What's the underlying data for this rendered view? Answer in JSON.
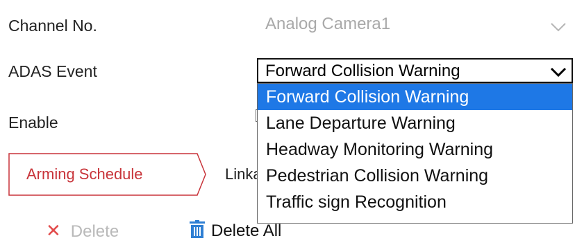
{
  "labels": {
    "channel": "Channel No.",
    "adas_event": "ADAS Event",
    "enable": "Enable"
  },
  "channel_select": {
    "value": "Analog Camera1",
    "disabled": true
  },
  "adas_select": {
    "value": "Forward Collision Warning",
    "options": [
      "Forward Collision Warning",
      "Lane Departure Warning",
      "Headway Monitoring Warning",
      "Pedestrian Collision Warning",
      "Traffic sign Recognition"
    ]
  },
  "tabs": {
    "active": "Arming Schedule",
    "next": "Linkage Method"
  },
  "buttons": {
    "delete": "Delete",
    "delete_all": "Delete All"
  },
  "colors": {
    "accent_red": "#c8343a",
    "selected_option": "#1e78e6",
    "trash_icon": "#2f7fd3"
  },
  "icons": {
    "delete": "x-icon",
    "delete_all": "trash-icon",
    "select": "chevron-down-icon"
  }
}
